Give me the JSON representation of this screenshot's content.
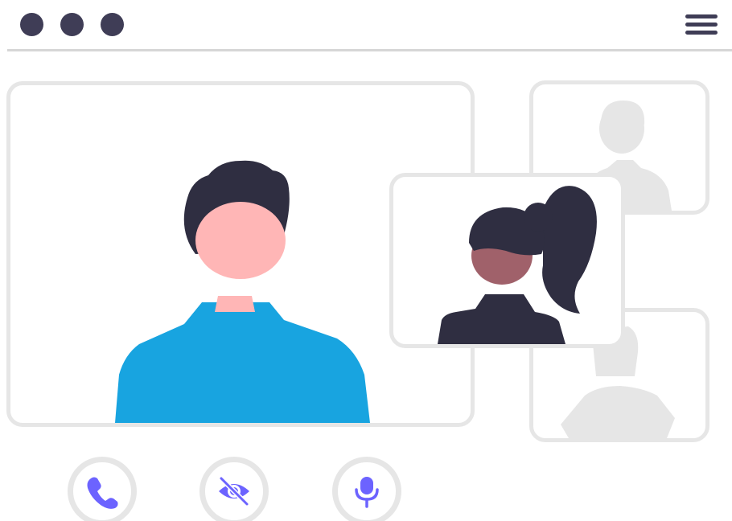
{
  "window": {
    "controls": [
      "dot-icon",
      "dot-icon",
      "dot-icon"
    ],
    "menu_icon": "hamburger-menu-icon"
  },
  "participants": [
    {
      "role": "main-speaker",
      "state": "active"
    },
    {
      "role": "self-view",
      "state": "active"
    },
    {
      "role": "participant",
      "state": "inactive"
    },
    {
      "role": "participant",
      "state": "inactive"
    }
  ],
  "call_controls": [
    {
      "name": "end-call",
      "icon": "phone-icon"
    },
    {
      "name": "toggle-video",
      "icon": "eye-slash-icon"
    },
    {
      "name": "toggle-microphone",
      "icon": "microphone-icon"
    }
  ],
  "colors": {
    "dark": "#3f3d56",
    "hair": "#2f2e41",
    "accent": "#6c63ff",
    "shirt": "#18a4e0",
    "skin": "#ffb6b6",
    "skin_dark": "#a0616a",
    "tile_border": "#e6e6e6",
    "placeholder": "#e6e6e6"
  }
}
